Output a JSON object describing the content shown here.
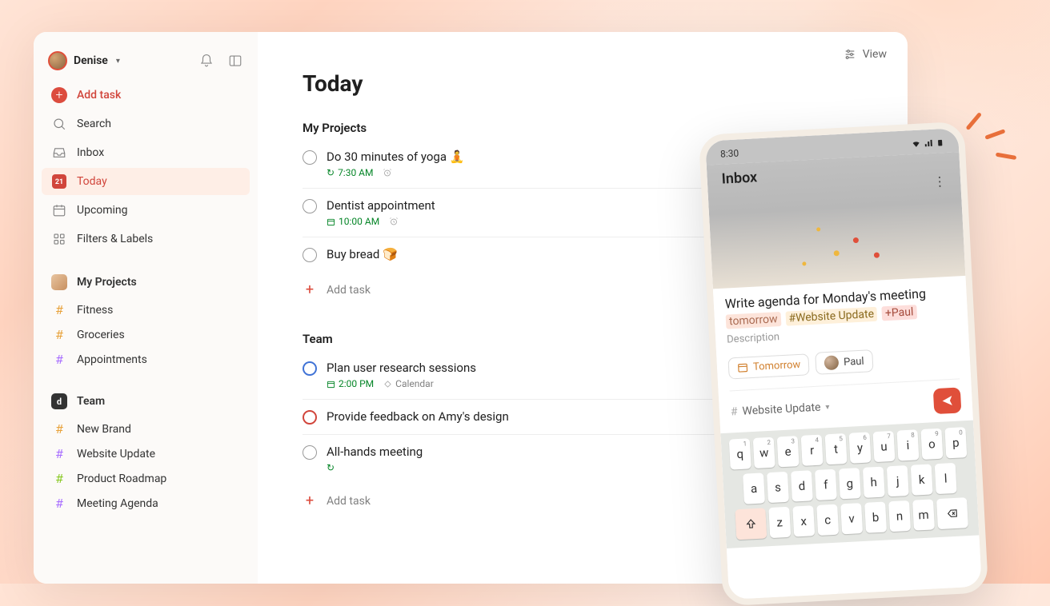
{
  "user": {
    "name": "Denise"
  },
  "sidebar": {
    "add_task": "Add task",
    "nav": {
      "search": "Search",
      "inbox": "Inbox",
      "today": "Today",
      "today_date": "21",
      "upcoming": "Upcoming",
      "filters": "Filters & Labels"
    },
    "my_projects": {
      "title": "My Projects",
      "items": [
        {
          "label": "Fitness",
          "color": "orange"
        },
        {
          "label": "Groceries",
          "color": "orange"
        },
        {
          "label": "Appointments",
          "color": "purple"
        }
      ]
    },
    "team": {
      "title": "Team",
      "badge": "d",
      "items": [
        {
          "label": "New Brand",
          "color": "orange"
        },
        {
          "label": "Website Update",
          "color": "purple"
        },
        {
          "label": "Product Roadmap",
          "color": "lime"
        },
        {
          "label": "Meeting Agenda",
          "color": "purple"
        }
      ]
    }
  },
  "main": {
    "view_label": "View",
    "title": "Today",
    "section_my_projects": "My Projects",
    "section_team": "Team",
    "add_task": "Add task",
    "tasks_my": [
      {
        "title": "Do 30 minutes of yoga 🧘",
        "time": "7:30 AM",
        "recurring": true,
        "alarm": true,
        "priority": ""
      },
      {
        "title": "Dentist appointment",
        "time": "10:00 AM",
        "recurring": false,
        "alarm": true,
        "priority": ""
      },
      {
        "title": "Buy bread 🍞",
        "time": "",
        "recurring": false,
        "alarm": false,
        "priority": ""
      }
    ],
    "tasks_team": [
      {
        "title": "Plan user research sessions",
        "time": "2:00 PM",
        "recurring": false,
        "alarm": false,
        "calendar": "Calendar",
        "priority": "p2"
      },
      {
        "title": "Provide feedback on Amy's design",
        "time": "",
        "recurring": false,
        "alarm": false,
        "priority": "p1"
      },
      {
        "title": "All-hands meeting",
        "time": "",
        "recurring": true,
        "alarm": false,
        "priority": ""
      }
    ]
  },
  "phone": {
    "time": "8:30",
    "header": "Inbox",
    "compose_title": "Write agenda for Monday's meeting",
    "tag_tomorrow": "tomorrow",
    "tag_project": "#Website Update",
    "tag_assignee": "+Paul",
    "description_placeholder": "Description",
    "chip_tomorrow": "Tomorrow",
    "chip_assignee": "Paul",
    "project_select": "Website Update",
    "keyboard": {
      "row1": [
        [
          "q",
          "1"
        ],
        [
          "w",
          "2"
        ],
        [
          "e",
          "3"
        ],
        [
          "r",
          "4"
        ],
        [
          "t",
          "5"
        ],
        [
          "y",
          "6"
        ],
        [
          "u",
          "7"
        ],
        [
          "i",
          "8"
        ],
        [
          "o",
          "9"
        ],
        [
          "p",
          "0"
        ]
      ],
      "row2": [
        "a",
        "s",
        "d",
        "f",
        "g",
        "h",
        "j",
        "k",
        "l"
      ],
      "row3": [
        "z",
        "x",
        "c",
        "v",
        "b",
        "n",
        "m"
      ]
    }
  }
}
